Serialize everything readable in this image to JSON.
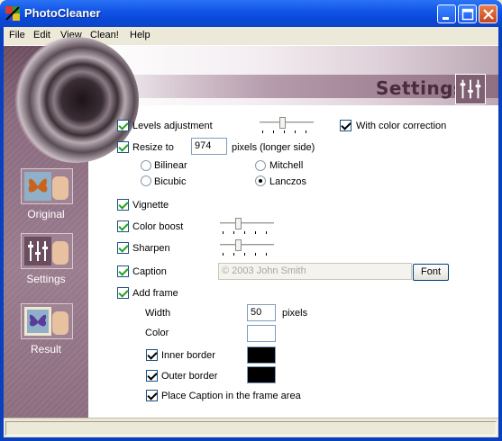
{
  "window": {
    "title": "PhotoCleaner"
  },
  "menu": [
    "File",
    "Edit",
    "View",
    "Clean!",
    "Help"
  ],
  "header": {
    "title": "Settings"
  },
  "nav": [
    {
      "label": "Original"
    },
    {
      "label": "Settings"
    },
    {
      "label": "Result"
    }
  ],
  "settings": {
    "levels_adjustment": {
      "label": "Levels adjustment",
      "checked": true,
      "slider_level": 0.4
    },
    "with_color_correction": {
      "label": "With color correction",
      "checked": true
    },
    "resize_to": {
      "label": "Resize to",
      "checked": true,
      "value": "974",
      "unit": "pixels (longer side)"
    },
    "resample": {
      "options": [
        "Bilinear",
        "Mitchell",
        "Bicubic",
        "Lanczos"
      ],
      "selected": "Lanczos"
    },
    "vignette": {
      "label": "Vignette",
      "checked": true
    },
    "color_boost": {
      "label": "Color boost",
      "checked": true,
      "slider_level": 0.3
    },
    "sharpen": {
      "label": "Sharpen",
      "checked": true,
      "slider_level": 0.3
    },
    "caption": {
      "label": "Caption",
      "checked": true,
      "value": "© 2003 John Smith",
      "font_button": "Font"
    },
    "add_frame": {
      "label": "Add frame",
      "checked": true
    },
    "frame": {
      "width_label": "Width",
      "width_value": "50",
      "width_unit": "pixels",
      "color_label": "Color",
      "inner_border": {
        "label": "Inner border",
        "checked": true
      },
      "outer_border": {
        "label": "Outer border",
        "checked": true
      },
      "place_caption": {
        "label": "Place Caption in the frame area",
        "checked": true
      }
    }
  },
  "colors": {
    "titlebar": "#0a48d8",
    "sidebar": "#8a6a7e",
    "check": "#21a121"
  }
}
